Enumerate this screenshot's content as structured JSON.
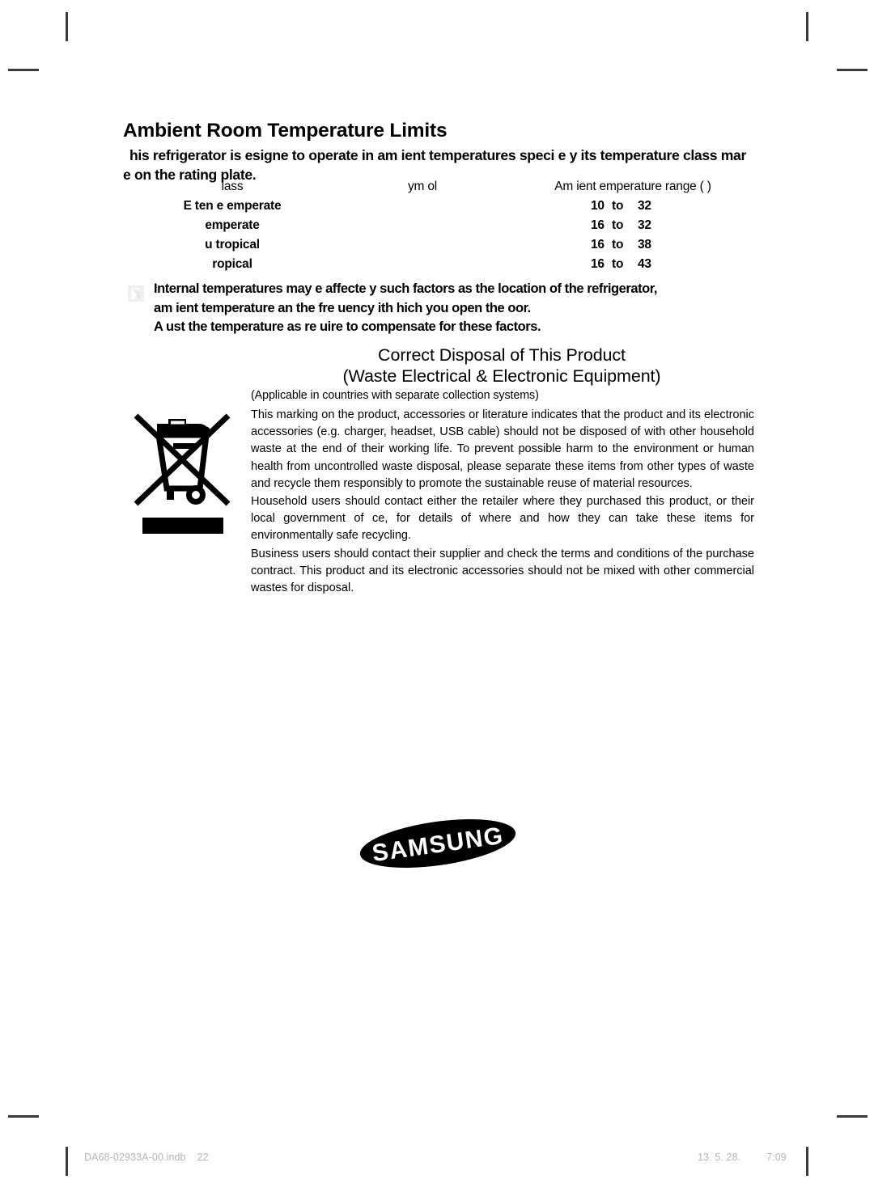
{
  "page": {
    "section_title": "Ambient Room Temperature Limits",
    "intro": "his refrigerator is  esigne  to operate in am ient temperatures speci e   y its temperature class mar e  on the rating plate."
  },
  "temp_table": {
    "headers": {
      "class": "lass",
      "symbol": "ym ol",
      "range": "Am ient  emperature range (  )"
    },
    "rows": [
      {
        "class": "E  ten e    emperate",
        "symbol": "",
        "low": "10",
        "to": "to",
        "high": "32"
      },
      {
        "class": "emperate",
        "symbol": "",
        "low": "16",
        "to": "to",
        "high": "32"
      },
      {
        "class": "u  tropical",
        "symbol": "",
        "low": "16",
        "to": "to",
        "high": "38"
      },
      {
        "class": "ropical",
        "symbol": "",
        "low": "16",
        "to": "to",
        "high": "43"
      }
    ]
  },
  "note": {
    "icon": "note-mark-icon",
    "line1": "Internal temperatures may  e affecte    y such factors as the location of the refrigerator,",
    "line2": "am ient temperature an  the fre uency  ith  hich you open the  oor.",
    "line3": "A  ust the temperature as re uire  to compensate for these factors."
  },
  "disposal": {
    "title_line1": "Correct Disposal of This Product",
    "title_line2": "(Waste Electrical & Electronic Equipment)",
    "applicable": "(Applicable in  countries with separate collection systems)",
    "paragraphs": [
      "This marking on the product, accessories or literature indicates that the product and its electronic accessories (e.g. charger, headset, USB cable) should not be disposed of with other household waste at the end of their working life. To prevent possible harm to the environment or human health from uncontrolled waste disposal, please separate these items from other types of waste and recycle them responsibly to promote the sustainable reuse of material resources.",
      "Household users should contact either the retailer where they purchased this product, or their local government of ce, for details of where and how they can take these items for environmentally safe recycling.",
      "Business users should contact their supplier and check the terms and conditions of the purchase contract. This product and its electronic accessories should not be mixed with other commercial wastes for disposal."
    ],
    "icon": "crossed-out-wheeled-bin-icon"
  },
  "brand": {
    "logo_text": "SAMSUNG",
    "logo_icon": "samsung-logo-icon"
  },
  "footer": {
    "file_name": "DA68-02933A-00.indb",
    "page_number": "22",
    "date": "13. 5. 28.",
    "time": "7:09"
  },
  "colors": {
    "text": "#000000",
    "footer_text": "#b4b4b4",
    "crop_mark": "#3a3a3a",
    "note_icon": "#e4e4e4"
  }
}
